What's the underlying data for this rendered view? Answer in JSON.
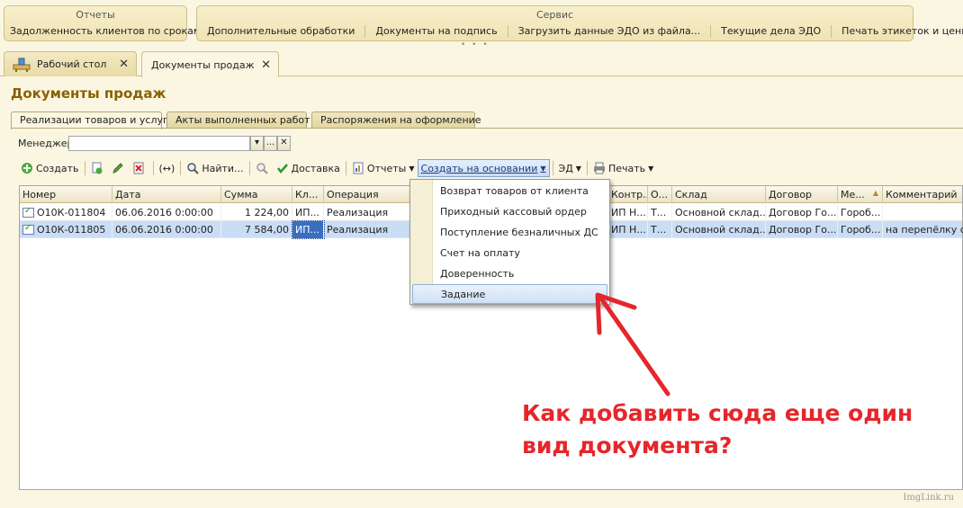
{
  "top_panels": {
    "reports": {
      "title": "Отчеты",
      "items": [
        "Задолженность клиентов по срокам"
      ]
    },
    "service": {
      "title": "Сервис",
      "items": [
        "Дополнительные обработки",
        "Документы на подпись",
        "Загрузить данные ЭДО из файла...",
        "Текущие дела ЭДО",
        "Печать этикеток и ценников"
      ]
    }
  },
  "window_tabs": [
    {
      "label": "Рабочий стол",
      "close": "✕"
    },
    {
      "label": "Документы продаж",
      "close": "✕"
    }
  ],
  "page_title": "Документы продаж",
  "form_tabs": [
    "Реализации товаров и услуг",
    "Акты выполненных работ",
    "Распоряжения на оформление"
  ],
  "manager": {
    "label": "Менеджер:",
    "value": "",
    "select_btn": "▾",
    "dots_btn": "...",
    "clear_btn": "✕"
  },
  "toolbar": {
    "create": "Создать",
    "find": "Найти...",
    "delivery": "Доставка",
    "reports": "Отчеты",
    "create_based_on": "Создать на основании",
    "ed": "ЭД",
    "print": "Печать",
    "arrows": "(↔)"
  },
  "table": {
    "columns": [
      "Номер",
      "Дата",
      "Сумма",
      "Кл...",
      "Операция",
      "Контр...",
      "О...",
      "Склад",
      "Договор",
      "Ме...",
      "Комментарий"
    ],
    "rows": [
      {
        "number": "О10К-011804",
        "date": "06.06.2016 0:00:00",
        "sum": "1 224,00",
        "client": "ИП...",
        "operation": "Реализация",
        "contractor": "ИП Н...",
        "o": "Т...",
        "warehouse": "Основной склад...",
        "contract": "Договор Го...",
        "manager": "Гороб...",
        "comment": ""
      },
      {
        "number": "О10К-011805",
        "date": "06.06.2016 0:00:00",
        "sum": "7 584,00",
        "client": "ИП...",
        "operation": "Реализация",
        "contractor": "ИП Н...",
        "o": "Т...",
        "warehouse": "Основной склад...",
        "contract": "Договор Го...",
        "manager": "Гороб...",
        "comment": "на перепёлку ск"
      }
    ]
  },
  "dropdown_items": [
    "Возврат товаров от клиента",
    "Приходный кассовый ордер",
    "Поступление безналичных ДС",
    "Счет на оплату",
    "Доверенность",
    "Задание"
  ],
  "annotation": {
    "text": "Как добавить сюда еще один вид документа?",
    "color": "#e5262b"
  },
  "watermark": "ImgLink.ru"
}
